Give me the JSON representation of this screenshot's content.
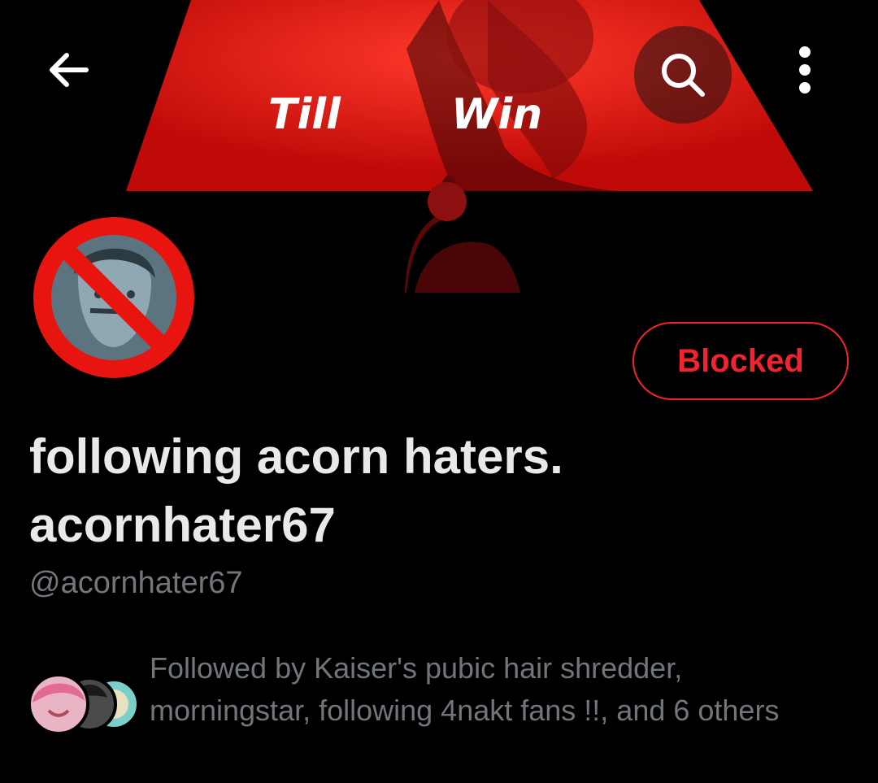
{
  "banner": {
    "text_left": "Till",
    "text_right": "Win",
    "accent_color": "#e8140f"
  },
  "header": {
    "back_icon": "arrow-left-icon",
    "search_icon": "search-icon",
    "more_icon": "more-vertical-icon"
  },
  "profile": {
    "avatar_overlay_icon": "prohibited-icon",
    "action_button_label": "Blocked",
    "display_name": "following acorn haters. acornhater67",
    "handle": "@acornhater67"
  },
  "followed_by": {
    "text": "Followed by Kaiser's pubic hair shredder, morningstar, following 4nakt fans !!, and 6 others"
  },
  "colors": {
    "background": "#000000",
    "primary_text": "#e7e9ea",
    "secondary_text": "#71767b",
    "blocked_red": "#f4212e"
  }
}
